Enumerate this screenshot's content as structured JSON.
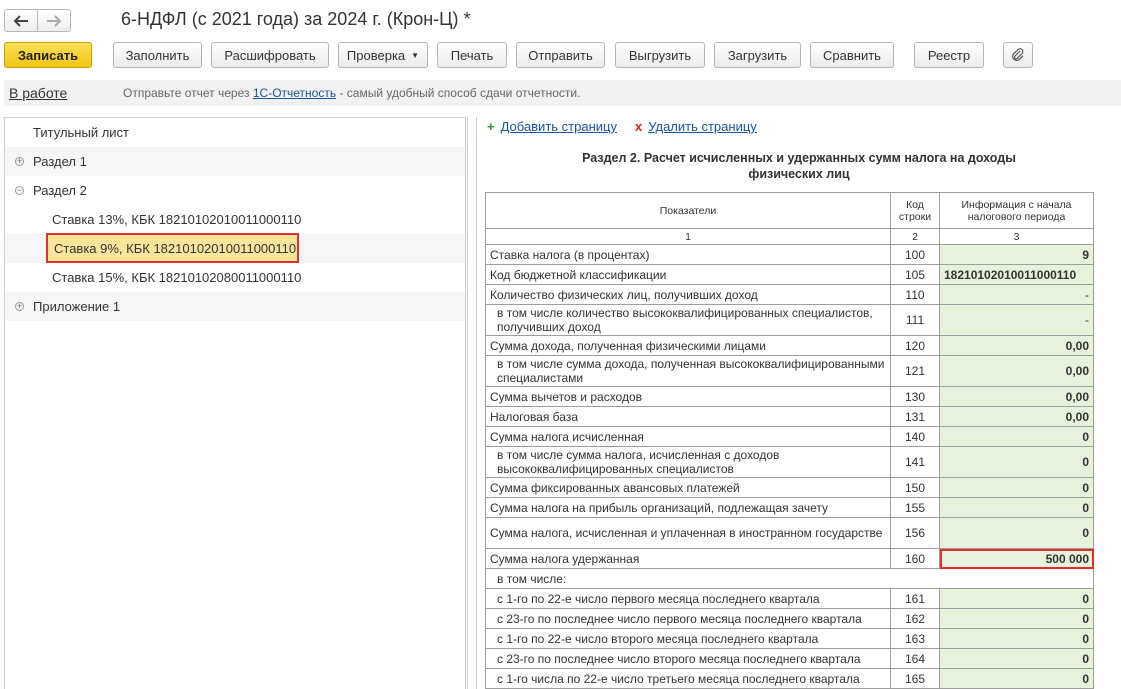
{
  "window": {
    "title": "6-НДФЛ (с 2021 года) за 2024 г. (Крон-Ц) *"
  },
  "toolbar": {
    "save": "Записать",
    "fill": "Заполнить",
    "decode": "Расшифровать",
    "check": "Проверка",
    "print": "Печать",
    "send": "Отправить",
    "export": "Выгрузить",
    "import": "Загрузить",
    "compare": "Сравнить",
    "registry": "Реестр"
  },
  "status": {
    "state_link": "В работе",
    "message_prefix": "Отправьте отчет через",
    "message_link": "1С-Отчетность",
    "message_suffix": "- самый удобный способ сдачи отчетности."
  },
  "tree": {
    "items": [
      {
        "label": "Титульный лист"
      },
      {
        "label": "Раздел 1"
      },
      {
        "label": "Раздел 2"
      },
      {
        "label": "Ставка 13%, КБК 18210102010011000110"
      },
      {
        "label": "Ставка 9%, КБК 18210102010011000110"
      },
      {
        "label": "Ставка 15%, КБК 18210102080011000110"
      },
      {
        "label": "Приложение 1"
      }
    ]
  },
  "form": {
    "add_page": "Добавить страницу",
    "delete_page": "Удалить страницу",
    "section_title_line1": "Раздел 2. Расчет исчисленных и удержанных сумм налога на доходы",
    "section_title_line2": "физических лиц",
    "headers": {
      "indicator": "Показатели",
      "code_line1": "Код",
      "code_line2": "строки",
      "info_line1": "Информация с начала",
      "info_line2": "налогового периода",
      "num1": "1",
      "num2": "2",
      "num3": "3"
    },
    "rows": [
      {
        "name": "Ставка налога (в процентах)",
        "code": "100",
        "value": "9"
      },
      {
        "name": "Код бюджетной классификации",
        "code": "105",
        "value": "18210102010011000110"
      },
      {
        "name": "Количество физических лиц, получивших доход",
        "code": "110",
        "value": "-"
      },
      {
        "name": "в том числе количество высококвалифицированных специалистов, получивших доход",
        "code": "111",
        "value": "-"
      },
      {
        "name": "Сумма дохода, полученная физическими лицами",
        "code": "120",
        "value": "0,00"
      },
      {
        "name": "в том числе сумма дохода, полученная высококвалифицированными специалистами",
        "code": "121",
        "value": "0,00"
      },
      {
        "name": "Сумма вычетов и расходов",
        "code": "130",
        "value": "0,00"
      },
      {
        "name": "Налоговая база",
        "code": "131",
        "value": "0,00"
      },
      {
        "name": "Сумма налога исчисленная",
        "code": "140",
        "value": "0"
      },
      {
        "name": "в том числе сумма налога, исчисленная с доходов высококвалифицированных специалистов",
        "code": "141",
        "value": "0"
      },
      {
        "name": "Сумма фиксированных авансовых платежей",
        "code": "150",
        "value": "0"
      },
      {
        "name": "Сумма налога на прибыль организаций, подлежащая зачету",
        "code": "155",
        "value": "0"
      },
      {
        "name": "Сумма налога, исчисленная и уплаченная в иностранном государстве",
        "code": "156",
        "value": "0"
      },
      {
        "name": "Сумма налога удержанная",
        "code": "160",
        "value": "500 000"
      },
      {
        "name": "в том числе:",
        "code": "",
        "value": ""
      },
      {
        "name": "с 1-го по 22-е число первого месяца последнего квартала",
        "code": "161",
        "value": "0"
      },
      {
        "name": "с 23-го по последнее число первого месяца последнего квартала",
        "code": "162",
        "value": "0"
      },
      {
        "name": "с 1-го по 22-е число второго месяца последнего квартала",
        "code": "163",
        "value": "0"
      },
      {
        "name": "с 23-го по последнее число второго месяца последнего квартала",
        "code": "164",
        "value": "0"
      },
      {
        "name": "с 1-го числа по 22-е число третьего месяца последнего квартала",
        "code": "165",
        "value": "0"
      }
    ]
  }
}
